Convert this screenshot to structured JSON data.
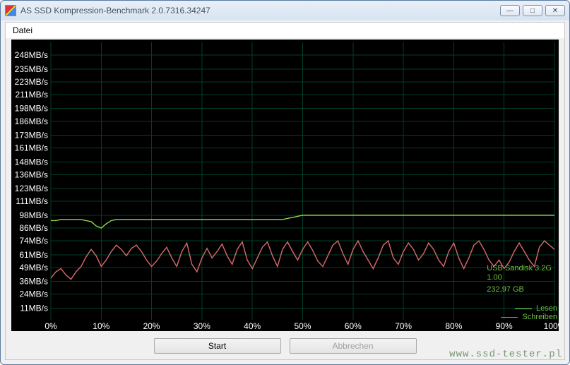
{
  "window": {
    "title": "AS SSD Kompression-Benchmark 2.0.7316.34247",
    "menu_file": "Datei",
    "btn_min": "—",
    "btn_max": "□",
    "btn_close": "✕"
  },
  "buttons": {
    "start": "Start",
    "cancel": "Abbrechen"
  },
  "watermark": "www.ssd-tester.pl",
  "info": {
    "device": "USB Sandisk 3.2G",
    "fw": "1.00",
    "capacity": "232,97 GB"
  },
  "legend": {
    "read": "Lesen",
    "write": "Schreiben"
  },
  "colors": {
    "read": "#8fd940",
    "write": "#d96a6a",
    "grid": "#003e29"
  },
  "chart_data": {
    "type": "line",
    "xlabel": "",
    "ylabel": "",
    "x_ticks": [
      "0%",
      "10%",
      "20%",
      "30%",
      "40%",
      "50%",
      "60%",
      "70%",
      "80%",
      "90%",
      "100%"
    ],
    "y_ticks": [
      "11MB/s",
      "24MB/s",
      "36MB/s",
      "49MB/s",
      "61MB/s",
      "74MB/s",
      "86MB/s",
      "98MB/s",
      "111MB/s",
      "123MB/s",
      "136MB/s",
      "148MB/s",
      "161MB/s",
      "173MB/s",
      "186MB/s",
      "198MB/s",
      "211MB/s",
      "223MB/s",
      "235MB/s",
      "248MB/s"
    ],
    "xlim": [
      0,
      100
    ],
    "ylim": [
      0,
      260
    ],
    "x": [
      0,
      1,
      2,
      3,
      4,
      5,
      6,
      7,
      8,
      9,
      10,
      11,
      12,
      13,
      14,
      15,
      16,
      17,
      18,
      19,
      20,
      21,
      22,
      23,
      24,
      25,
      26,
      27,
      28,
      29,
      30,
      31,
      32,
      33,
      34,
      35,
      36,
      37,
      38,
      39,
      40,
      41,
      42,
      43,
      44,
      45,
      46,
      47,
      48,
      49,
      50,
      51,
      52,
      53,
      54,
      55,
      56,
      57,
      58,
      59,
      60,
      61,
      62,
      63,
      64,
      65,
      66,
      67,
      68,
      69,
      70,
      71,
      72,
      73,
      74,
      75,
      76,
      77,
      78,
      79,
      80,
      81,
      82,
      83,
      84,
      85,
      86,
      87,
      88,
      89,
      90,
      91,
      92,
      93,
      94,
      95,
      96,
      97,
      98,
      99,
      100
    ],
    "series": [
      {
        "name": "Lesen",
        "color": "#8fd940",
        "values": [
          93,
          93,
          94,
          94,
          94,
          94,
          94,
          93,
          92,
          88,
          86,
          90,
          93,
          94,
          94,
          94,
          94,
          94,
          94,
          94,
          94,
          94,
          94,
          94,
          94,
          94,
          94,
          94,
          94,
          94,
          94,
          94,
          94,
          94,
          94,
          94,
          94,
          94,
          94,
          94,
          94,
          94,
          94,
          94,
          94,
          94,
          94,
          95,
          96,
          97,
          98,
          98,
          98,
          98,
          98,
          98,
          98,
          98,
          98,
          98,
          98,
          98,
          98,
          98,
          98,
          98,
          98,
          98,
          98,
          98,
          98,
          98,
          98,
          98,
          98,
          98,
          98,
          98,
          98,
          98,
          98,
          98,
          98,
          98,
          98,
          98,
          98,
          98,
          98,
          98,
          98,
          98,
          98,
          98,
          98,
          98,
          98,
          98,
          98,
          98,
          98
        ]
      },
      {
        "name": "Schreiben",
        "color": "#d96a6a",
        "values": [
          39,
          45,
          48,
          42,
          38,
          45,
          50,
          59,
          66,
          60,
          50,
          56,
          64,
          70,
          66,
          60,
          67,
          70,
          64,
          56,
          50,
          55,
          62,
          68,
          58,
          50,
          64,
          72,
          52,
          45,
          58,
          67,
          58,
          64,
          71,
          60,
          52,
          66,
          73,
          56,
          48,
          58,
          68,
          73,
          60,
          50,
          66,
          73,
          64,
          56,
          66,
          73,
          65,
          55,
          50,
          60,
          70,
          74,
          62,
          52,
          66,
          74,
          64,
          56,
          48,
          58,
          70,
          74,
          58,
          52,
          64,
          72,
          66,
          56,
          62,
          72,
          66,
          56,
          50,
          64,
          72,
          58,
          48,
          58,
          70,
          74,
          66,
          56,
          50,
          56,
          48,
          54,
          64,
          72,
          64,
          56,
          50,
          68,
          74,
          70,
          66
        ]
      }
    ]
  }
}
